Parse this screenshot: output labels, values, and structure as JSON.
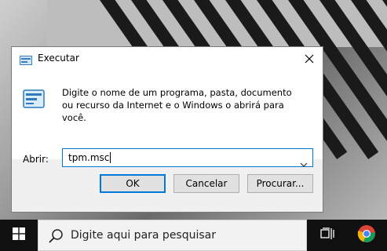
{
  "dialog": {
    "title": "Executar",
    "description": "Digite o nome de um programa, pasta, documento ou recurso da Internet e o Windows o abrirá para você.",
    "open_label": "Abrir:",
    "open_value": "tpm.msc",
    "buttons": {
      "ok": "OK",
      "cancel": "Cancelar",
      "browse": "Procurar..."
    },
    "icons": {
      "title": "run-icon",
      "main": "run-icon",
      "close": "close-icon",
      "dropdown": "chevron-down-icon"
    }
  },
  "taskbar": {
    "search_placeholder": "Digite aqui para pesquisar",
    "icons": {
      "start": "windows-logo-icon",
      "search": "search-icon",
      "task_view": "task-view-icon",
      "browser": "chrome-icon"
    }
  },
  "colors": {
    "accent": "#0078d7",
    "taskbar": "#101010",
    "dialog_bg": "#f0f0f0"
  }
}
